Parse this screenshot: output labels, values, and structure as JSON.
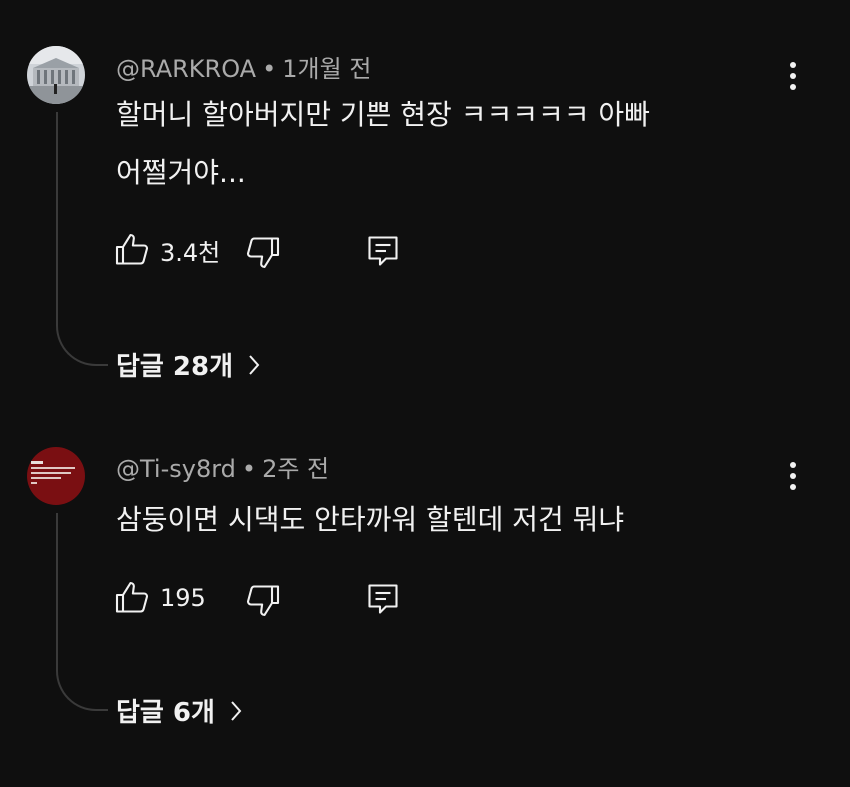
{
  "comments": [
    {
      "author": "@RARKROA",
      "time": "1개월 전",
      "text_lines": [
        "할머니 할아버지만 기쁜 현장 ㅋㅋㅋㅋㅋ 아빠",
        "어쩔거야..."
      ],
      "likes": "3.4천",
      "replies_label": "답글 28개",
      "avatar_icon": "building-photo-avatar"
    },
    {
      "author": "@Ti-sy8rd",
      "time": "2주 전",
      "text_lines": [
        "삼둥이면 시댁도 안타까워 할텐데 저건 뭐냐"
      ],
      "likes": "195",
      "replies_label": "답글 6개",
      "avatar_icon": "red-thumbnail-avatar"
    }
  ],
  "separator": "•",
  "colors": {
    "background": "#0f0f0f",
    "text_primary": "#f1f1f1",
    "text_secondary": "#aaaaaa",
    "thread_line": "#3a3a3a"
  }
}
